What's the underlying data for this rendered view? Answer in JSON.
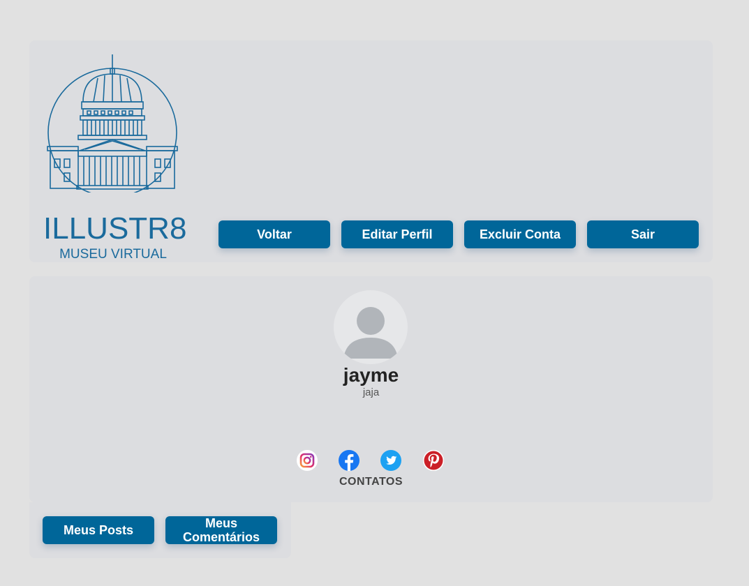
{
  "brand": {
    "title": "ILLUSTR8",
    "subtitle": "MUSEU VIRTUAL",
    "logo_icon": "museum-dome-icon",
    "color": "#1a6a9c"
  },
  "nav": {
    "back_label": "Voltar",
    "edit_label": "Editar Perfil",
    "delete_label": "Excluir Conta",
    "logout_label": "Sair"
  },
  "profile": {
    "avatar_icon": "user-avatar-icon",
    "username": "jayme",
    "handle": "jaja",
    "contacts_label": "CONTATOS",
    "socials": [
      {
        "name": "instagram",
        "icon": "instagram-icon"
      },
      {
        "name": "facebook",
        "icon": "facebook-icon"
      },
      {
        "name": "twitter",
        "icon": "twitter-icon"
      },
      {
        "name": "pinterest",
        "icon": "pinterest-icon"
      }
    ]
  },
  "tabs": {
    "posts_label": "Meus Posts",
    "comments_label": "Meus Comentários"
  },
  "colors": {
    "accent": "#006699",
    "page_bg": "#e1e1e1",
    "panel_bg": "#dcdde0"
  }
}
